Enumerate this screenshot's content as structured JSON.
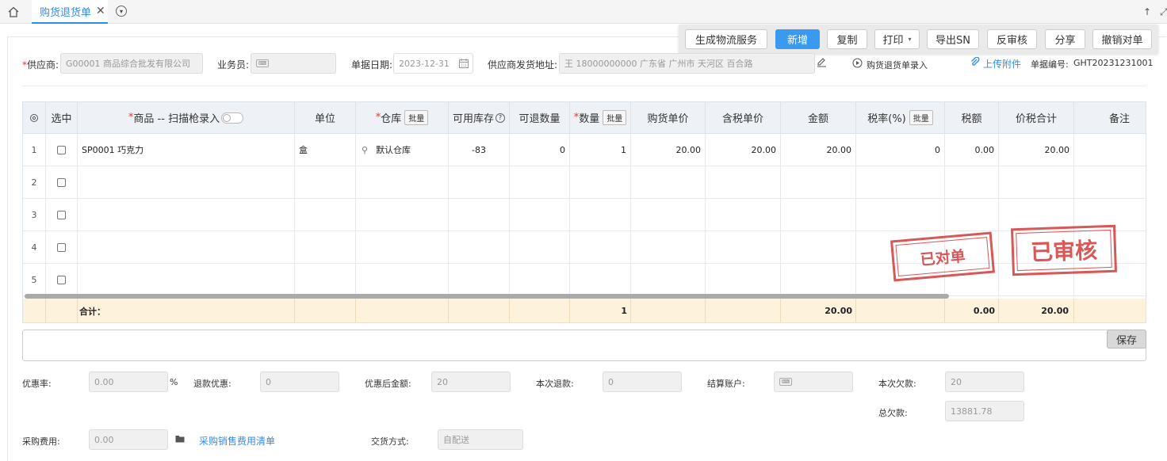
{
  "tab": {
    "title": "购货退货单",
    "close": "✕"
  },
  "toolbar": {
    "logistics": "生成物流服务",
    "new": "新增",
    "copy": "复制",
    "print": "打印",
    "export_sn": "导出SN",
    "unaudit": "反审核",
    "share": "分享",
    "cancel_reconcile": "撤销对单"
  },
  "header": {
    "supplier_label": "供应商:",
    "supplier_value": "G00001 商品综合批发有限公司",
    "salesman_label": "业务员:",
    "date_label": "单据日期:",
    "date_value": "2023-12-31",
    "address_label": "供应商发货地址:",
    "address_value": "王 18000000000 广东省 广州市 天河区 百合路",
    "entry_link": "购货退货单录入",
    "upload_link": "上传附件",
    "docno_label": "单据编号:",
    "docno_value": "GHT20231231001"
  },
  "grid": {
    "columns": {
      "select": "选中",
      "product": "商品 -- 扫描枪录入",
      "unit": "单位",
      "warehouse": "仓库",
      "batch": "批量",
      "available": "可用库存",
      "returnable": "可退数量",
      "qty": "数量",
      "price": "购货单价",
      "tax_price": "含税单价",
      "amount": "金额",
      "tax_rate": "税率(%)",
      "tax": "税额",
      "total": "价税合计",
      "remark": "备注"
    },
    "rows": [
      {
        "no": "1",
        "product": "SP0001 巧克力",
        "unit": "盒",
        "warehouse": "默认仓库",
        "available": "-83",
        "returnable": "0",
        "qty": "1",
        "price": "20.00",
        "tax_price": "20.00",
        "amount": "20.00",
        "tax_rate": "0",
        "tax": "0.00",
        "total": "20.00"
      },
      {
        "no": "2"
      },
      {
        "no": "3"
      },
      {
        "no": "4"
      },
      {
        "no": "5"
      }
    ],
    "totals": {
      "label": "合计：",
      "qty": "1",
      "amount": "20.00",
      "tax": "0.00",
      "total": "20.00"
    }
  },
  "stamps": {
    "reconciled": "已对单",
    "audited": "已审核"
  },
  "footer": {
    "save": "保存",
    "discount_rate_label": "优惠率:",
    "discount_rate_value": "0.00",
    "percent": "%",
    "refund_discount_label": "退款优惠:",
    "refund_discount_value": "0",
    "after_discount_label": "优惠后金额:",
    "after_discount_value": "20",
    "this_refund_label": "本次退款:",
    "this_refund_value": "0",
    "settle_account_label": "结算账户:",
    "this_debt_label": "本次欠款:",
    "this_debt_value": "20",
    "total_debt_label": "总欠款:",
    "total_debt_value": "13881.78",
    "purchase_fee_label": "采购费用:",
    "purchase_fee_value": "0.00",
    "fee_list_link": "采购销售费用清单",
    "delivery_label": "交货方式:",
    "delivery_value": "自配送"
  }
}
